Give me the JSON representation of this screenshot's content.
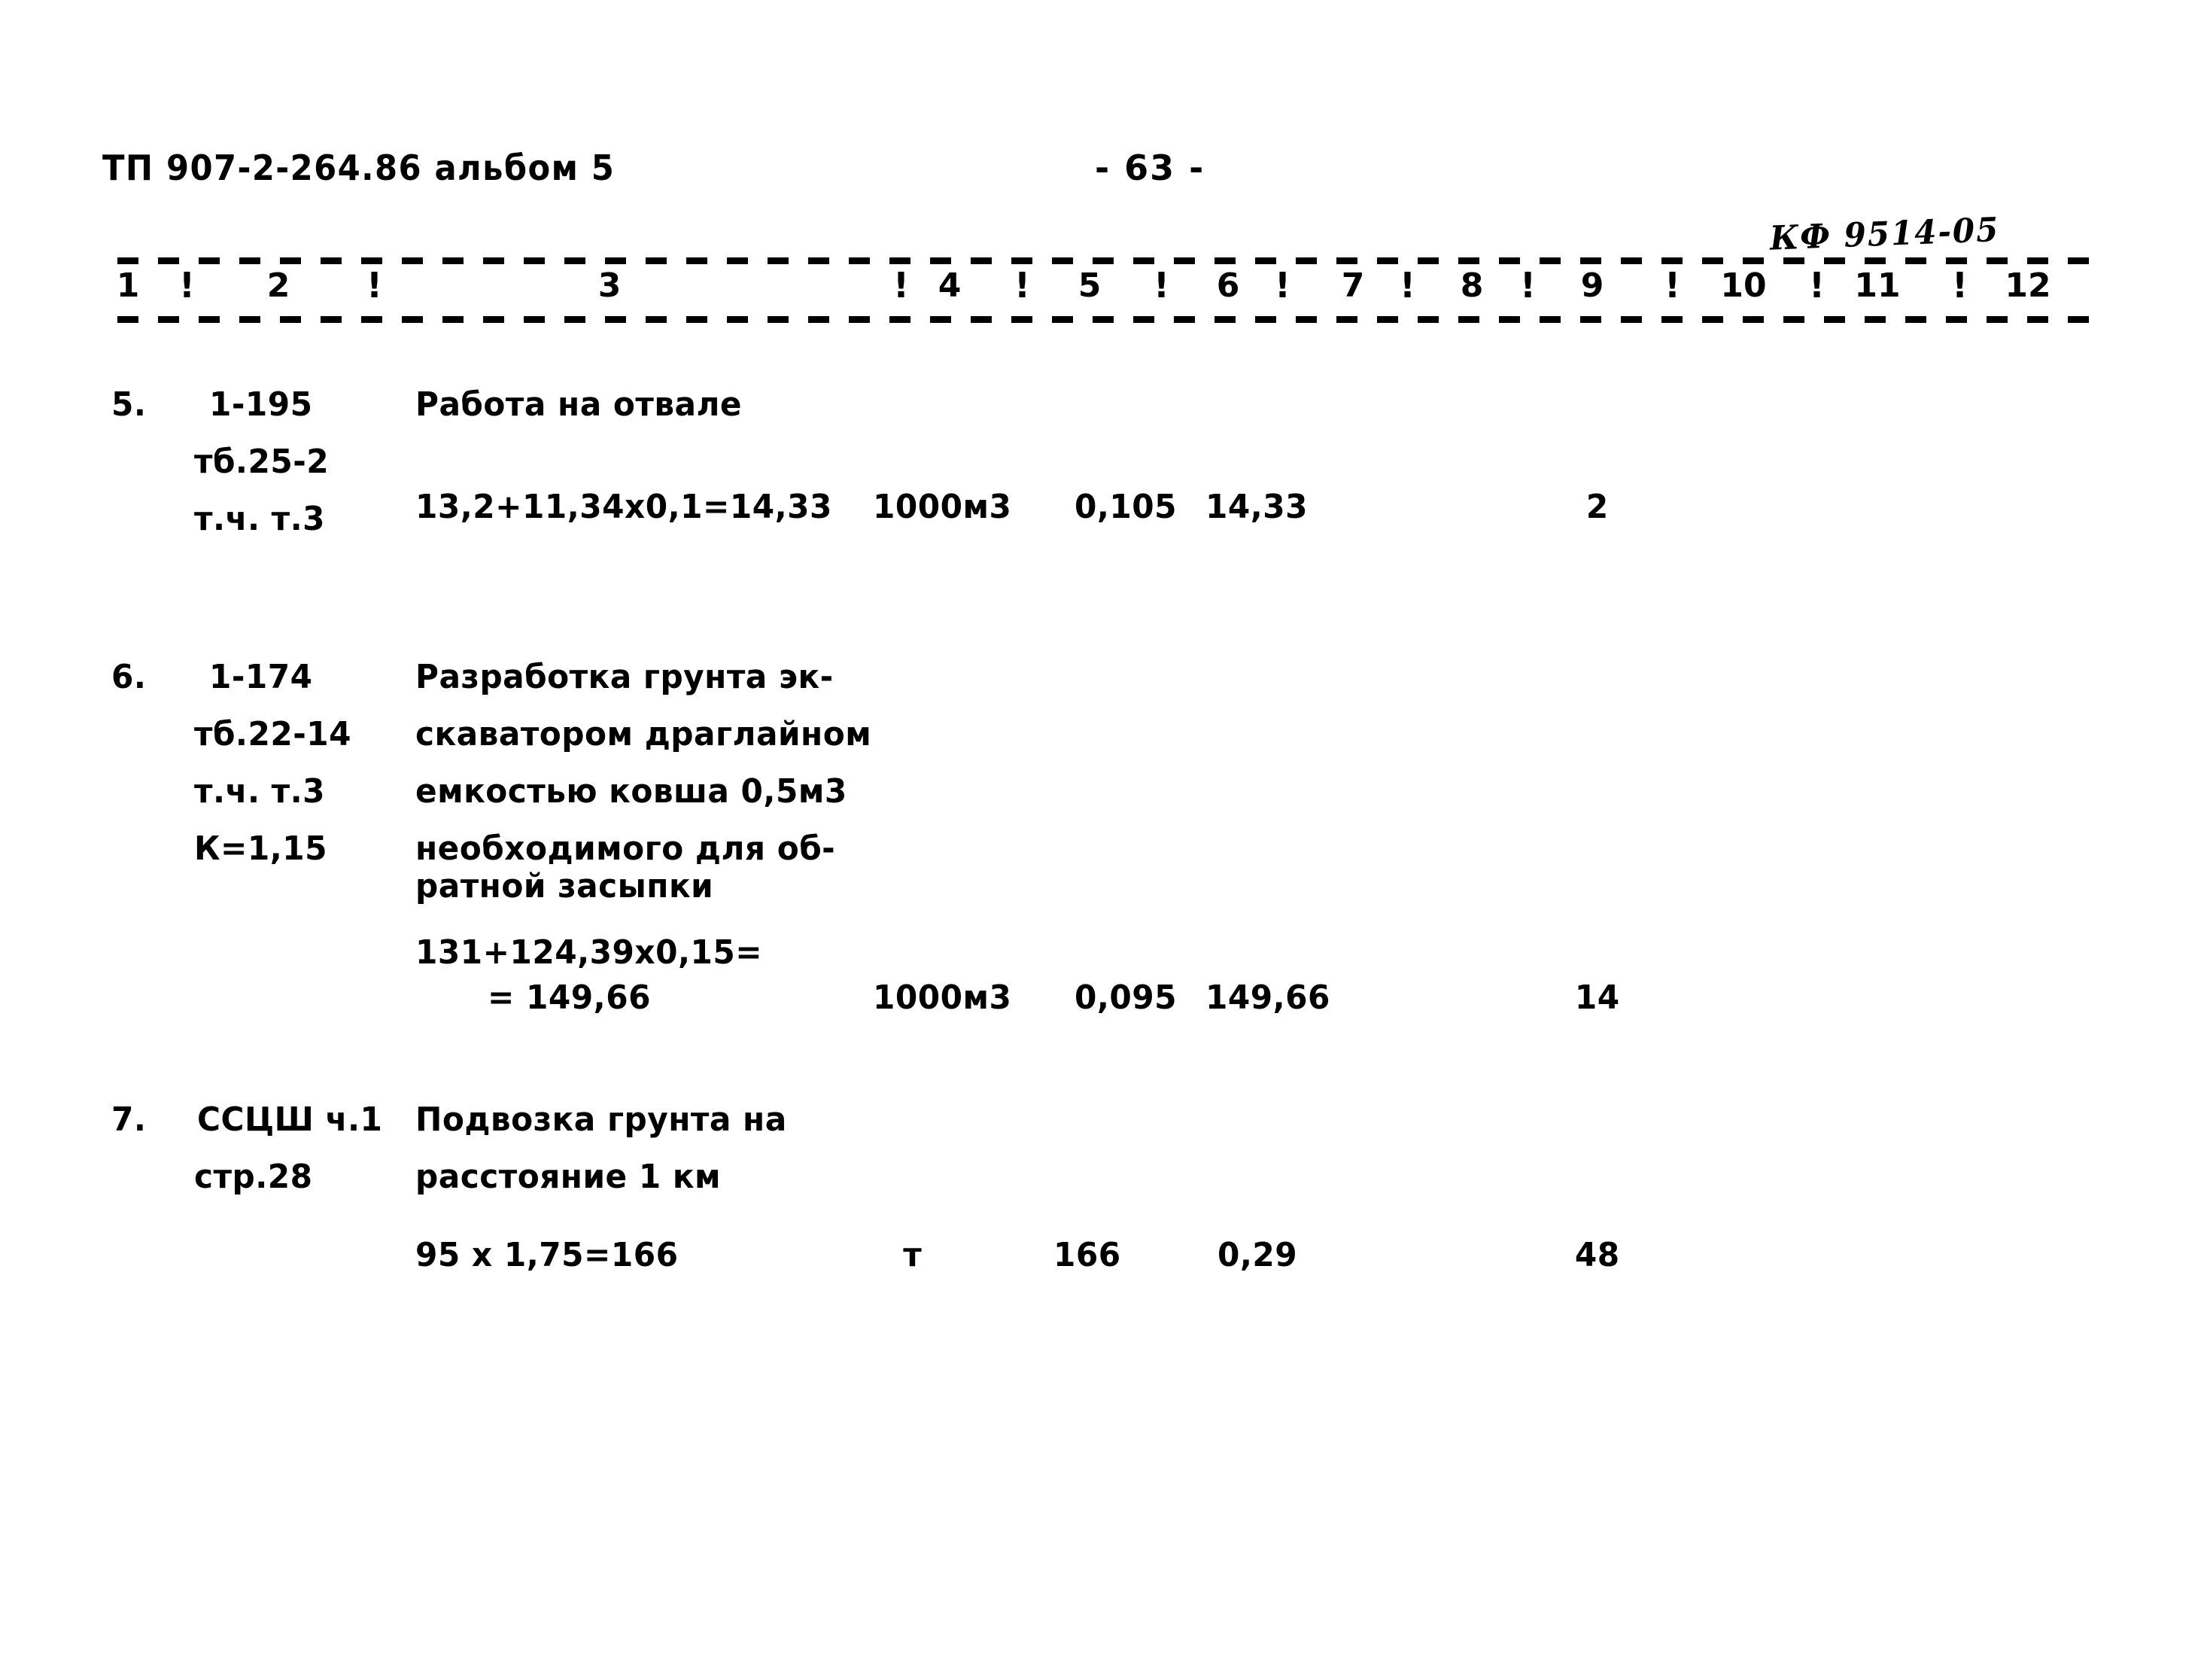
{
  "document": {
    "header_left": "ТП 907-2-264.86  альбом 5",
    "page_label": "- 63 -",
    "handwritten_note": "КФ 9514-05"
  },
  "table": {
    "column_numbers": [
      "1",
      "2",
      "3",
      "4",
      "5",
      "6",
      "7",
      "8",
      "9",
      "10",
      "11",
      "12"
    ],
    "separator": "!",
    "rows": [
      {
        "index": "5.",
        "code_lines": [
          "1-195",
          "тб.25-2",
          "т.ч. т.3"
        ],
        "description_lines": [
          "Работа на отвале"
        ],
        "calculation": "13,2+11,34х0,1=14,33",
        "unit": "1000м3",
        "col5": "0,105",
        "col6": "14,33",
        "col9": "2"
      },
      {
        "index": "6.",
        "code_lines": [
          "1-174",
          "тб.22-14",
          "т.ч. т.3",
          "К=1,15"
        ],
        "description_lines": [
          "Разработка грунта эк-",
          "скаватором драглайном",
          "емкостью ковша 0,5м3",
          "необходимого для об-",
          "ратной засыпки"
        ],
        "calculation_line1": "131+124,39х0,15=",
        "calculation_line2": "= 149,66",
        "unit": "1000м3",
        "col5": "0,095",
        "col6": "149,66",
        "col9": "14"
      },
      {
        "index": "7.",
        "code_lines": [
          "ССЦШ ч.1",
          "стр.28"
        ],
        "description_lines": [
          "Подвозка грунта на",
          "расстояние 1 км"
        ],
        "calculation": "95 х 1,75=166",
        "unit": "т",
        "col5": "166",
        "col6": "0,29",
        "col9": "48"
      }
    ]
  }
}
